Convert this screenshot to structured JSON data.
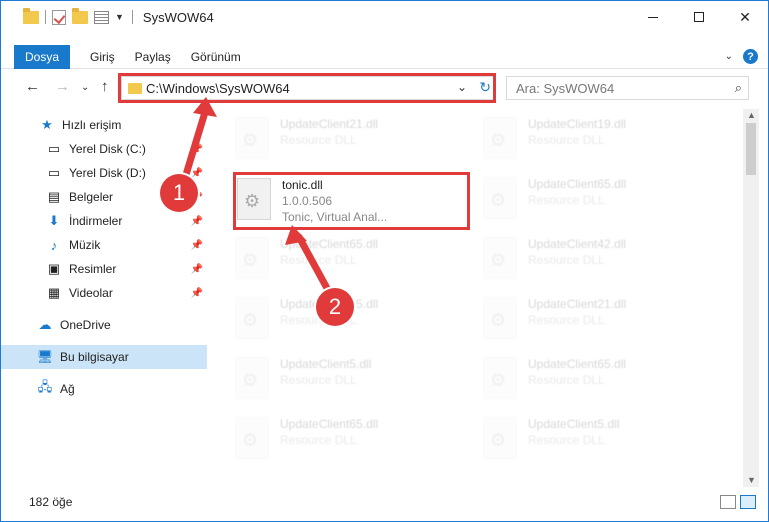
{
  "window": {
    "title": "SysWOW64",
    "close_glyph": "✕"
  },
  "ribbon": {
    "tabs": [
      "Dosya",
      "Giriş",
      "Paylaş",
      "Görünüm"
    ]
  },
  "address": {
    "path": "C:\\Windows\\SysWOW64",
    "search_placeholder": "Ara: SysWOW64"
  },
  "nav_pane": {
    "items": [
      {
        "label": "Hızlı erişim",
        "icon": "star-icon",
        "pinned": false
      },
      {
        "label": "Yerel Disk (C:)",
        "icon": "drive-icon",
        "pinned": true
      },
      {
        "label": "Yerel Disk (D:)",
        "icon": "drive-icon",
        "pinned": true
      },
      {
        "label": "Belgeler",
        "icon": "documents-icon",
        "pinned": true
      },
      {
        "label": "İndirmeler",
        "icon": "download-icon",
        "pinned": true
      },
      {
        "label": "Müzik",
        "icon": "music-icon",
        "pinned": true
      },
      {
        "label": "Resimler",
        "icon": "pictures-icon",
        "pinned": true
      },
      {
        "label": "Videolar",
        "icon": "video-icon",
        "pinned": true
      },
      {
        "label": "OneDrive",
        "icon": "cloud-icon",
        "pinned": false
      },
      {
        "label": "Bu bilgisayar",
        "icon": "computer-icon",
        "pinned": false,
        "selected": true
      },
      {
        "label": "Ağ",
        "icon": "network-icon",
        "pinned": false
      }
    ]
  },
  "files": {
    "highlighted": {
      "name": "tonic.dll",
      "version": "1.0.0.506",
      "description": "Tonic, Virtual Anal..."
    },
    "background": [
      {
        "name": "UpdateClient21.dll",
        "type": "Resource DLL"
      },
      {
        "name": "UpdateClient19.dll",
        "type": "Resource DLL"
      },
      {
        "name": "UpdateClient65.dll",
        "type": "Resource DLL"
      },
      {
        "name": "UpdateClient65.dll",
        "type": "Resource DLL"
      },
      {
        "name": "UpdateClient42.dll",
        "type": "Resource DLL"
      },
      {
        "name": "UpdateClient65.dll",
        "type": "Resource DLL"
      },
      {
        "name": "UpdateClient21.dll",
        "type": "Resource DLL"
      },
      {
        "name": "UpdateClient5.dll",
        "type": "Resource DLL"
      },
      {
        "name": "UpdateClient65.dll",
        "type": "Resource DLL"
      },
      {
        "name": "UpdateClient65.dll",
        "type": "Resource DLL"
      },
      {
        "name": "UpdateClient5.dll",
        "type": "Resource DLL"
      }
    ]
  },
  "status": {
    "count": "182 öğe"
  },
  "callouts": {
    "one": "1",
    "two": "2"
  },
  "colors": {
    "accent": "#1979ca",
    "highlight": "#e03a3a",
    "selection": "#cce4f7"
  }
}
